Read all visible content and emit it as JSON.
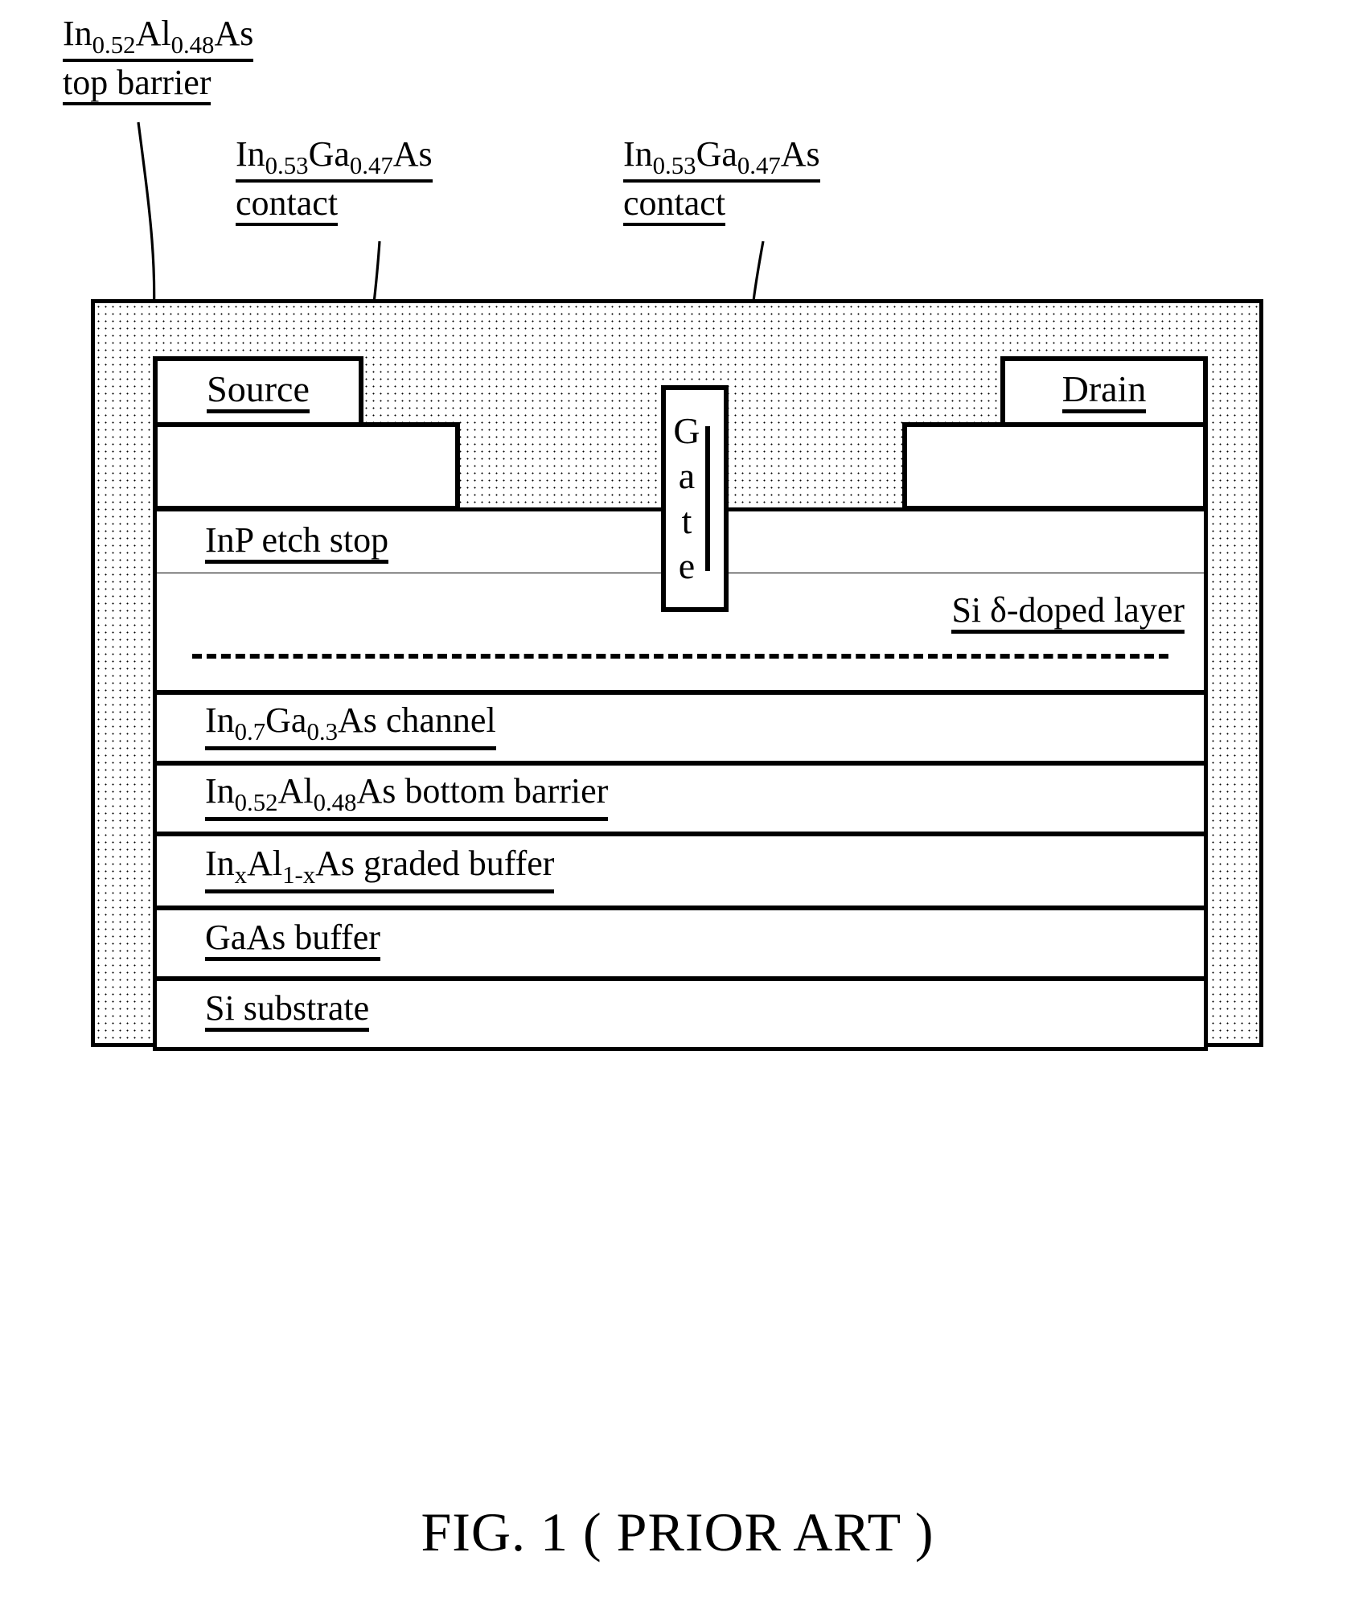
{
  "figure": {
    "caption": "FIG. 1 ( PRIOR ART )",
    "title_line": "FIG. 1 ( PRIOR ART )"
  },
  "callouts": [
    {
      "id": "top-barrier",
      "formula_prefix": "In",
      "sub1": "0.52",
      "formula_mid": "Al",
      "sub2": "0.48",
      "formula_suffix": "As",
      "line2": "top barrier",
      "full_text": "In0.52Al0.48As top barrier"
    },
    {
      "id": "contact-left",
      "formula_prefix": "In",
      "sub1": "0.53",
      "formula_mid": "Ga",
      "sub2": "0.47",
      "formula_suffix": "As",
      "line2": "contact",
      "full_text": "In0.53Ga0.47As contact"
    },
    {
      "id": "contact-right",
      "formula_prefix": "In",
      "sub1": "0.53",
      "formula_mid": "Ga",
      "sub2": "0.47",
      "formula_suffix": "As",
      "line2": "contact",
      "full_text": "In0.53Ga0.47As contact"
    }
  ],
  "device": {
    "source_label": "Source",
    "drain_label": "Drain",
    "gate_letters": [
      "G",
      "a",
      "t",
      "e"
    ],
    "gate_label": "Gate",
    "etch_stop_label": "InP etch stop",
    "delta_doped_label": "Si δ-doped layer",
    "layers": [
      {
        "id": "channel",
        "prefix": "In",
        "sub1": "0.7",
        "mid": "Ga",
        "sub2": "0.3",
        "suffix": "As channel",
        "full_text": "In0.7Ga0.3As channel"
      },
      {
        "id": "bottom-barrier",
        "prefix": "In",
        "sub1": "0.52",
        "mid": "Al",
        "sub2": "0.48",
        "suffix": "As bottom barrier",
        "full_text": "In0.52Al0.48As bottom barrier"
      },
      {
        "id": "graded-buffer",
        "prefix": "In",
        "sub1": "x",
        "mid": "Al",
        "sub2": "1-x",
        "suffix": "As graded buffer",
        "full_text": "InxAl1-xAs graded buffer"
      },
      {
        "id": "gaas-buffer",
        "prefix": "GaAs buffer",
        "sub1": "",
        "mid": "",
        "sub2": "",
        "suffix": "",
        "full_text": "GaAs buffer"
      },
      {
        "id": "si-substrate",
        "prefix": "Si substrate",
        "sub1": "",
        "mid": "",
        "sub2": "",
        "suffix": "",
        "full_text": "Si substrate"
      }
    ]
  },
  "colors": {
    "ink": "#000000",
    "paper": "#ffffff"
  }
}
